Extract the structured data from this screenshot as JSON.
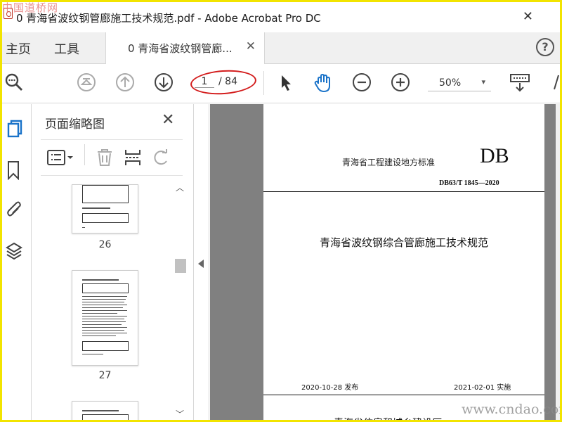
{
  "window": {
    "title": "0 青海省波纹钢管廊施工技术规范.pdf - Adobe Acrobat Pro DC",
    "close_glyph": "✕",
    "watermark_top": "中国道桥网"
  },
  "tabs": {
    "home": "主页",
    "tools": "工具",
    "document": "0 青海省波纹钢管廊...",
    "document_close": "✕",
    "help": "?"
  },
  "toolbar": {
    "page_current": "1",
    "page_total": "/ 84",
    "zoom": "50%",
    "zoom_caret": "▾"
  },
  "thumbnails_panel": {
    "title": "页面缩略图",
    "close": "✕",
    "pages": [
      {
        "number": "26"
      },
      {
        "number": "27"
      },
      {
        "number": ""
      }
    ],
    "scroll_up": "︿",
    "scroll_down": "﹀"
  },
  "document": {
    "standard_label": "青海省工程建设地方标准",
    "db": "DB",
    "code": "DB63/T 1845—2020",
    "title": "青海省波纹钢综合管廊施工技术规范",
    "issue_date": "2020-10-28 发布",
    "effective_date": "2021-02-01 实施",
    "publisher": "青海省住房和城乡建设厅"
  },
  "watermark_bottom": "www.cndao.com",
  "colors": {
    "frame": "#f2e400",
    "highlight": "#d31c1c",
    "hand_tool": "#1a73c9",
    "rail_active": "#1a73c9"
  },
  "icons": [
    "search-icon",
    "first-page-icon",
    "previous-page-icon",
    "next-page-icon",
    "select-arrow-icon",
    "hand-icon",
    "zoom-out-icon",
    "zoom-in-icon",
    "keyboard-icon",
    "thumbnails-icon",
    "bookmark-icon",
    "attachment-icon",
    "layers-icon",
    "options-icon",
    "delete-icon",
    "insert-icon",
    "rotate-icon"
  ]
}
